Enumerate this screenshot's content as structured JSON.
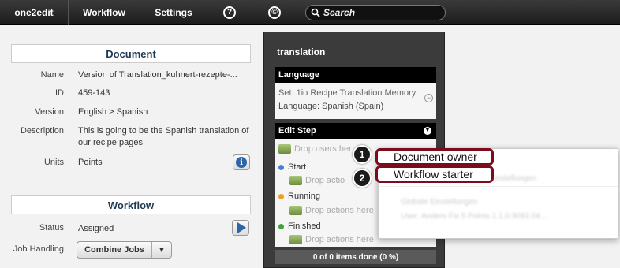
{
  "topbar": {
    "brand": "one2edit",
    "workflow": "Workflow",
    "settings": "Settings",
    "help_glyph": "?",
    "copyright_glyph": "©",
    "search_placeholder": "Search",
    "icons": [
      "help-icon",
      "copyright-icon",
      "search-icon"
    ]
  },
  "document": {
    "header": "Document",
    "rows": [
      {
        "label": "Name",
        "value": "Version of Translation_kuhnert-rezepte-..."
      },
      {
        "label": "ID",
        "value": "459-143"
      },
      {
        "label": "Version",
        "value": "English > Spanish"
      },
      {
        "label": "Description",
        "value": "This is going to be the Spanish translation of our recipe pages."
      },
      {
        "label": "Units",
        "value": "Points"
      }
    ],
    "info_glyph": "i"
  },
  "workflow": {
    "header": "Workflow",
    "status_label": "Status",
    "status_value": "Assigned",
    "job_handling_label": "Job Handling",
    "job_handling_value": "Combine Jobs",
    "dropdown_glyph": "▼"
  },
  "translation": {
    "title": "translation",
    "language_header": "Language",
    "set_line": "Set: 1io Recipe Translation Memory",
    "language_line": "Language: Spanish (Spain)",
    "minus_glyph": "−",
    "edit_step_header": "Edit Step",
    "chevron_glyph": "▼",
    "drop_users": "Drop users her",
    "stages": [
      {
        "name": "Start",
        "color": "#4a7fd4"
      },
      {
        "name": "Running",
        "color": "#f0a020"
      },
      {
        "name": "Finished",
        "color": "#3aa53a"
      }
    ],
    "drop_actions_short": "Drop actio",
    "drop_actions": "Drop actions here",
    "progress": "0 of 0 items done (0 %)"
  },
  "popup": {
    "options": [
      "Document owner",
      "Workflow starter"
    ],
    "badges": [
      "1",
      "2"
    ],
    "blurred": [
      "Einstellungen",
      "Globale Einstellungen",
      "User: Anders Fix 5 Points 1.1.0.9093.04..."
    ]
  }
}
